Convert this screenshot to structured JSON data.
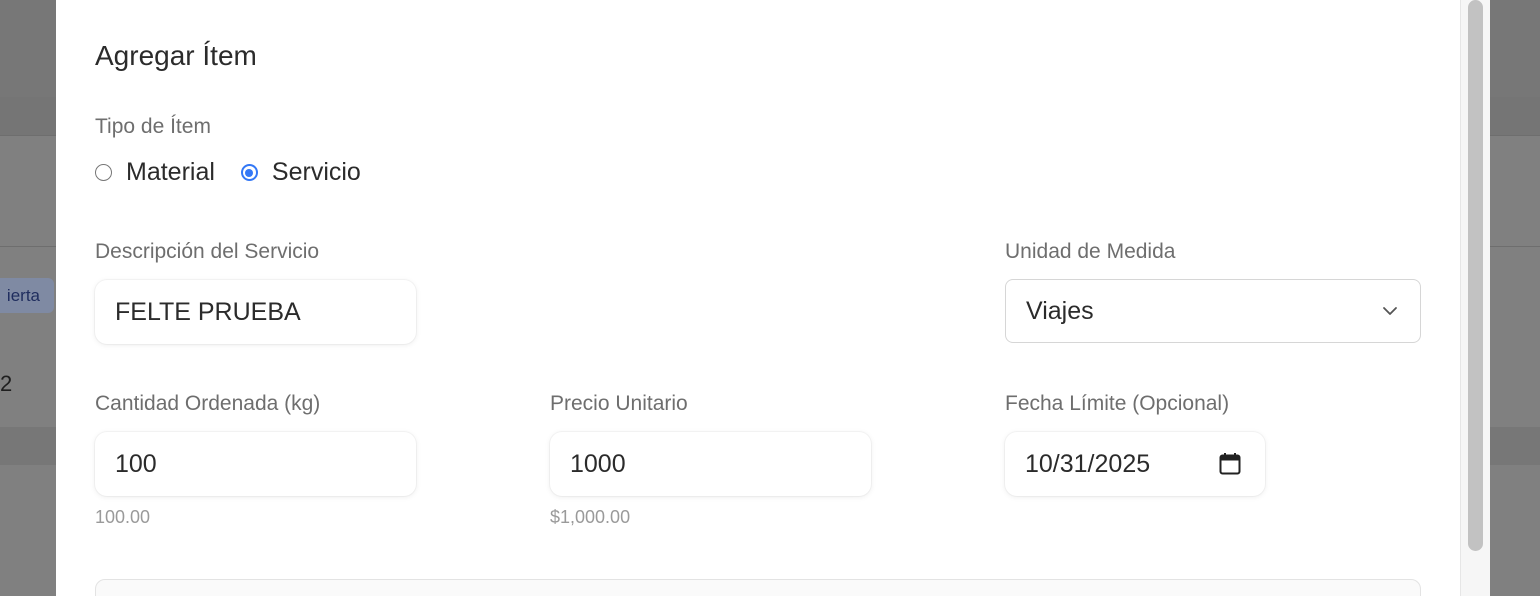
{
  "background": {
    "badge_text": "ierta",
    "row_number": "2"
  },
  "modal": {
    "title": "Agregar Ítem",
    "item_type": {
      "label": "Tipo de Ítem",
      "options": [
        {
          "label": "Material",
          "checked": false
        },
        {
          "label": "Servicio",
          "checked": true
        }
      ]
    },
    "description": {
      "label": "Descripción del Servicio",
      "value": "FELTE PRUEBA"
    },
    "unit": {
      "label": "Unidad de Medida",
      "value": "Viajes"
    },
    "quantity": {
      "label": "Cantidad Ordenada (kg)",
      "value": "100",
      "hint": "100.00"
    },
    "unit_price": {
      "label": "Precio Unitario",
      "value": "1000",
      "hint": "$1,000.00"
    },
    "due_date": {
      "label": "Fecha Límite (Opcional)",
      "value": "10/31/2025"
    }
  },
  "colors": {
    "accent": "#3478f6",
    "label": "#6e6e6e",
    "text": "#2b2b2b",
    "overlay": "#808080"
  }
}
